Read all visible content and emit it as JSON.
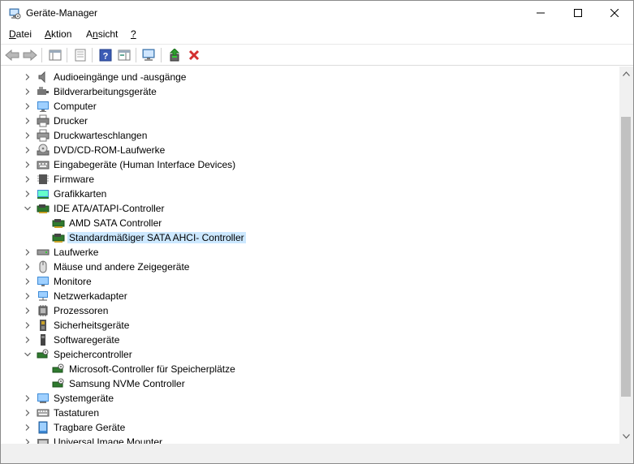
{
  "window": {
    "title": "Geräte-Manager"
  },
  "menu": [
    {
      "label": "Datei",
      "accel": "D",
      "rest": "atei"
    },
    {
      "label": "Aktion",
      "accel": "A",
      "rest": "ktion"
    },
    {
      "label": "Ansicht",
      "accel": "n",
      "pre": "A",
      "rest": "sicht"
    },
    {
      "label": "?",
      "accel": "?",
      "rest": ""
    }
  ],
  "tree": [
    {
      "label": "Audioeingänge und -ausgänge",
      "icon": "speaker-icon",
      "expanded": false,
      "level": 0
    },
    {
      "label": "Bildverarbeitungsgeräte",
      "icon": "camera-icon",
      "expanded": false,
      "level": 0
    },
    {
      "label": "Computer",
      "icon": "computer-icon",
      "expanded": false,
      "level": 0
    },
    {
      "label": "Drucker",
      "icon": "printer-icon",
      "expanded": false,
      "level": 0
    },
    {
      "label": "Druckwarteschlangen",
      "icon": "print-queue-icon",
      "expanded": false,
      "level": 0
    },
    {
      "label": "DVD/CD-ROM-Laufwerke",
      "icon": "disc-drive-icon",
      "expanded": false,
      "level": 0
    },
    {
      "label": "Eingabegeräte (Human Interface Devices)",
      "icon": "hid-icon",
      "expanded": false,
      "level": 0
    },
    {
      "label": "Firmware",
      "icon": "firmware-icon",
      "expanded": false,
      "level": 0
    },
    {
      "label": "Grafikkarten",
      "icon": "display-adapter-icon",
      "expanded": false,
      "level": 0
    },
    {
      "label": "IDE ATA/ATAPI-Controller",
      "icon": "ide-controller-icon",
      "expanded": true,
      "level": 0
    },
    {
      "label": "AMD SATA Controller",
      "icon": "ide-controller-icon",
      "level": 1
    },
    {
      "label": "Standardmäßiger SATA AHCI- Controller",
      "icon": "ide-controller-icon",
      "level": 1,
      "selected": true
    },
    {
      "label": "Laufwerke",
      "icon": "disk-drive-icon",
      "expanded": false,
      "level": 0
    },
    {
      "label": "Mäuse und andere Zeigegeräte",
      "icon": "mouse-icon",
      "expanded": false,
      "level": 0
    },
    {
      "label": "Monitore",
      "icon": "monitor-icon",
      "expanded": false,
      "level": 0
    },
    {
      "label": "Netzwerkadapter",
      "icon": "network-adapter-icon",
      "expanded": false,
      "level": 0
    },
    {
      "label": "Prozessoren",
      "icon": "processor-icon",
      "expanded": false,
      "level": 0
    },
    {
      "label": "Sicherheitsgeräte",
      "icon": "security-device-icon",
      "expanded": false,
      "level": 0
    },
    {
      "label": "Softwaregeräte",
      "icon": "software-device-icon",
      "expanded": false,
      "level": 0
    },
    {
      "label": "Speichercontroller",
      "icon": "storage-controller-icon",
      "expanded": true,
      "level": 0
    },
    {
      "label": "Microsoft-Controller für Speicherplätze",
      "icon": "storage-controller-icon",
      "level": 1
    },
    {
      "label": "Samsung NVMe Controller",
      "icon": "storage-controller-icon",
      "level": 1
    },
    {
      "label": "Systemgeräte",
      "icon": "system-device-icon",
      "expanded": false,
      "level": 0
    },
    {
      "label": "Tastaturen",
      "icon": "keyboard-icon",
      "expanded": false,
      "level": 0
    },
    {
      "label": "Tragbare Geräte",
      "icon": "portable-device-icon",
      "expanded": false,
      "level": 0
    },
    {
      "label": "Universal Image Mounter",
      "icon": "image-mounter-icon",
      "expanded": false,
      "level": 0
    }
  ],
  "colors": {
    "selection": "#cce8ff",
    "accent": "#0078d7",
    "delete": "#d32f2f"
  }
}
